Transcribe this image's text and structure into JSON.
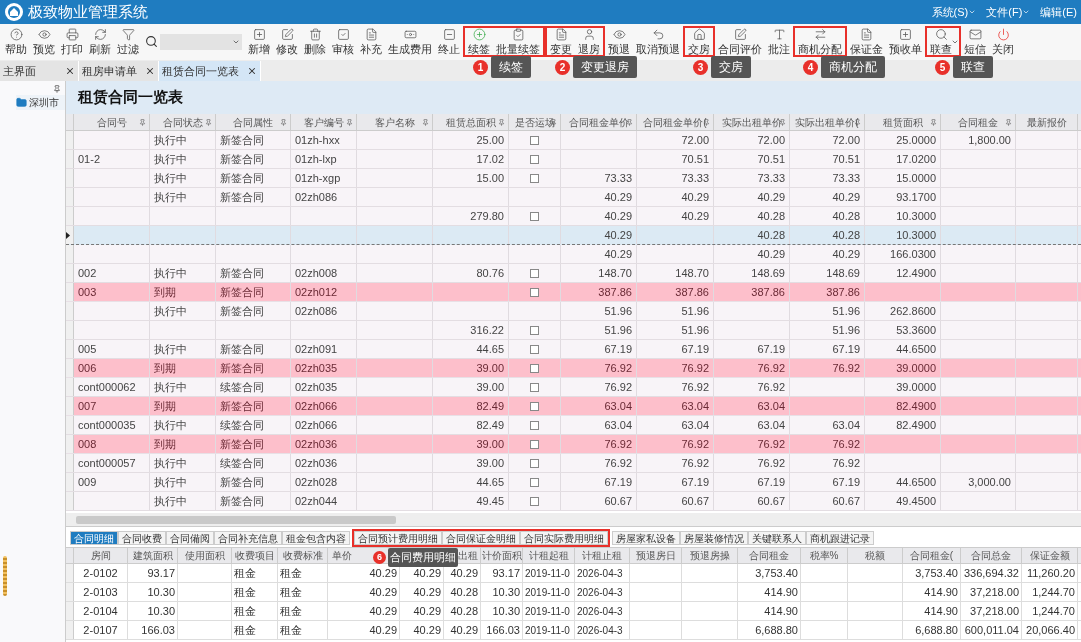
{
  "app": {
    "title": "极致物业管理系统",
    "menus": [
      "系统(S)",
      "文件(F)",
      "编辑(E)"
    ]
  },
  "toolbar": {
    "groups": [
      {
        "items": [
          {
            "label": "帮助"
          },
          {
            "label": "预览"
          },
          {
            "label": "打印"
          },
          {
            "label": "刷新"
          },
          {
            "label": "过滤"
          },
          {
            "kind": "search"
          },
          {
            "label": "新增"
          },
          {
            "label": "修改"
          },
          {
            "label": "删除"
          },
          {
            "label": "审核"
          },
          {
            "label": "补充"
          },
          {
            "label": "生成费用"
          },
          {
            "label": "终止"
          }
        ]
      },
      {
        "callout": {
          "number": "1",
          "label": "续签"
        },
        "items": [
          {
            "label": "续签"
          },
          {
            "label": "批量续签"
          }
        ]
      },
      {
        "callout": {
          "number": "2",
          "label": "变更退房"
        },
        "items": [
          {
            "label": "变更"
          },
          {
            "label": "退房"
          }
        ]
      },
      {
        "items": [
          {
            "label": "预退"
          },
          {
            "label": "取消预退"
          }
        ]
      },
      {
        "callout": {
          "number": "3",
          "label": "交房"
        },
        "items": [
          {
            "label": "交房"
          }
        ]
      },
      {
        "items": [
          {
            "label": "合同评价"
          },
          {
            "label": "批注"
          }
        ]
      },
      {
        "callout": {
          "number": "4",
          "label": "商机分配"
        },
        "items": [
          {
            "label": "商机分配"
          }
        ]
      },
      {
        "items": [
          {
            "label": "保证金"
          },
          {
            "label": "预收单"
          }
        ]
      },
      {
        "callout": {
          "number": "5",
          "label": "联查"
        },
        "items": [
          {
            "label": "联查",
            "dropdown": true
          }
        ]
      },
      {
        "items": [
          {
            "label": "短信"
          },
          {
            "label": "关闭"
          }
        ]
      }
    ]
  },
  "doc_tabs": [
    {
      "label": "主界面",
      "selected": false
    },
    {
      "label": "租房申请单",
      "selected": false
    },
    {
      "label": "租赁合同一览表",
      "selected": true
    }
  ],
  "sidebar": {
    "items": [
      {
        "label": "深圳市"
      }
    ]
  },
  "page_title": "租赁合同一览表",
  "table": {
    "columns": [
      "合同号",
      "合同状态",
      "合同属性",
      "客户编号",
      "客户名称",
      "租赁总面积",
      "是否运场",
      "合同租金单价",
      "合同租金单价(",
      "实际出租单价",
      "实际出租单价(",
      "租赁面积",
      "合同租金",
      "最新报价"
    ],
    "rows": [
      {
        "selected": false,
        "expired": false,
        "status": "执行中",
        "attr": "新签合同",
        "cust": "01zh-hxx",
        "area": "25.00",
        "checked": false,
        "p2": "72.00",
        "p3": "72.00",
        "p4": "72.00",
        "lease_area": "25.0000",
        "rent": "1,800.00"
      },
      {
        "selected": false,
        "expired": false,
        "no": "01-2",
        "status": "执行中",
        "attr": "新签合同",
        "cust": "01zh-lxp",
        "area": "17.02",
        "checked": false,
        "p2": "70.51",
        "p3": "70.51",
        "p4": "70.51",
        "lease_area": "17.0200"
      },
      {
        "selected": false,
        "expired": false,
        "status": "执行中",
        "attr": "新签合同",
        "cust": "01zh-xgp",
        "area": "15.00",
        "checked": false,
        "p1": "73.33",
        "p2": "73.33",
        "p3": "73.33",
        "p4": "73.33",
        "lease_area": "15.0000"
      },
      {
        "selected": false,
        "expired": false,
        "status": "执行中",
        "attr": "新签合同",
        "cust": "02zh086",
        "p1": "40.29",
        "p2": "40.29",
        "p3": "40.29",
        "p4": "40.29",
        "lease_area": "93.1700"
      },
      {
        "selected": false,
        "expired": false,
        "area": "279.80",
        "checked": false,
        "p1": "40.29",
        "p2": "40.29",
        "p3": "40.28",
        "p4": "40.28",
        "lease_area": "10.3000"
      },
      {
        "selected": true,
        "expired": false,
        "p1": "40.29",
        "p3": "40.28",
        "p4": "40.28",
        "lease_area": "10.3000"
      },
      {
        "selected": false,
        "expired": false,
        "p1": "40.29",
        "p3": "40.29",
        "p4": "40.29",
        "lease_area": "166.0300"
      },
      {
        "selected": false,
        "expired": false,
        "no": "002",
        "status": "执行中",
        "attr": "新签合同",
        "cust": "02zh008",
        "area": "80.76",
        "checked": false,
        "p1": "148.70",
        "p2": "148.70",
        "p3": "148.69",
        "p4": "148.69",
        "lease_area": "12.4900"
      },
      {
        "selected": false,
        "expired": true,
        "no": "003",
        "status": "到期",
        "attr": "新签合同",
        "cust": "02zh012",
        "checked": false,
        "p1": "387.86",
        "p2": "387.86",
        "p3": "387.86",
        "p4": "387.86"
      },
      {
        "selected": false,
        "expired": false,
        "status": "执行中",
        "attr": "新签合同",
        "cust": "02zh086",
        "p1": "51.96",
        "p2": "51.96",
        "p4": "51.96",
        "lease_area": "262.8600"
      },
      {
        "selected": false,
        "expired": false,
        "area": "316.22",
        "checked": false,
        "p1": "51.96",
        "p2": "51.96",
        "p4": "51.96",
        "lease_area": "53.3600"
      },
      {
        "selected": false,
        "expired": false,
        "no": "005",
        "status": "执行中",
        "attr": "新签合同",
        "cust": "02zh091",
        "area": "44.65",
        "checked": false,
        "p1": "67.19",
        "p2": "67.19",
        "p3": "67.19",
        "p4": "67.19",
        "lease_area": "44.6500"
      },
      {
        "selected": false,
        "expired": true,
        "no": "006",
        "status": "到期",
        "attr": "新签合同",
        "cust": "02zh035",
        "area": "39.00",
        "checked": false,
        "p1": "76.92",
        "p2": "76.92",
        "p3": "76.92",
        "p4": "76.92",
        "lease_area": "39.0000"
      },
      {
        "selected": false,
        "expired": false,
        "no": "cont000062",
        "status": "执行中",
        "attr": "续签合同",
        "cust": "02zh035",
        "area": "39.00",
        "checked": false,
        "p1": "76.92",
        "p2": "76.92",
        "p3": "76.92",
        "lease_area": "39.0000"
      },
      {
        "selected": false,
        "expired": true,
        "no": "007",
        "status": "到期",
        "attr": "新签合同",
        "cust": "02zh066",
        "area": "82.49",
        "checked": false,
        "p1": "63.04",
        "p2": "63.04",
        "p3": "63.04",
        "lease_area": "82.4900"
      },
      {
        "selected": false,
        "expired": false,
        "no": "cont000035",
        "status": "执行中",
        "attr": "续签合同",
        "cust": "02zh066",
        "area": "82.49",
        "checked": false,
        "p1": "63.04",
        "p2": "63.04",
        "p3": "63.04",
        "p4": "63.04",
        "lease_area": "82.4900"
      },
      {
        "selected": false,
        "expired": true,
        "no": "008",
        "status": "到期",
        "attr": "新签合同",
        "cust": "02zh036",
        "area": "39.00",
        "checked": false,
        "p1": "76.92",
        "p2": "76.92",
        "p3": "76.92",
        "p4": "76.92"
      },
      {
        "selected": false,
        "expired": false,
        "no": "cont000057",
        "status": "执行中",
        "attr": "续签合同",
        "cust": "02zh036",
        "area": "39.00",
        "checked": false,
        "p1": "76.92",
        "p2": "76.92",
        "p3": "76.92",
        "p4": "76.92"
      },
      {
        "selected": false,
        "expired": false,
        "no": "009",
        "status": "执行中",
        "attr": "新签合同",
        "cust": "02zh028",
        "area": "44.65",
        "checked": false,
        "p1": "67.19",
        "p2": "67.19",
        "p3": "67.19",
        "p4": "67.19",
        "lease_area": "44.6500",
        "rent": "3,000.00"
      },
      {
        "selected": false,
        "expired": false,
        "status": "执行中",
        "attr": "新签合同",
        "cust": "02zh044",
        "area": "49.45",
        "checked": false,
        "p1": "60.67",
        "p2": "60.67",
        "p3": "60.67",
        "p4": "60.67",
        "lease_area": "49.4500"
      }
    ]
  },
  "detail_tabs": [
    {
      "tabs": [
        {
          "label": "合同明细",
          "selected": true
        },
        {
          "label": "合同收费",
          "selected": false
        },
        {
          "label": "合同備阅",
          "selected": false
        },
        {
          "label": "合同补充信息",
          "selected": false
        },
        {
          "label": "租金包含内容",
          "selected": false
        }
      ]
    },
    {
      "callout": {
        "number": "6",
        "label": "合同费用明细"
      },
      "tabs": [
        {
          "label": "合同预计费用明细",
          "selected": false
        },
        {
          "label": "合同保证金明细",
          "selected": false
        },
        {
          "label": "合同实际费用明细",
          "selected": false
        }
      ]
    },
    {
      "tabs": [
        {
          "label": "房屋家私设备",
          "selected": false
        },
        {
          "label": "房屋装修情况",
          "selected": false
        },
        {
          "label": "关键联系人",
          "selected": false
        },
        {
          "label": "商机跟进记录",
          "selected": false
        }
      ]
    }
  ],
  "detail_table": {
    "columns": [
      "房间",
      "建筑面积",
      "使用面积",
      "收费项目",
      "收费标准",
      "单价",
      null,
      "出租",
      "计价面积",
      "计租起租",
      "计租止租",
      "预退房日",
      "预退房操",
      "合同租金",
      "税率%",
      "税额",
      "合同租金(",
      "合同总金",
      "保证金额"
    ],
    "rows": [
      {
        "cells": [
          "2-0102",
          "93.17",
          null,
          "租金",
          "租金",
          "40.29",
          "40.29",
          "40.29",
          "93.17",
          "2019-11-0",
          "2026-04-3",
          null,
          null,
          "3,753.40",
          null,
          null,
          "3,753.40",
          "336,694.32",
          "11,260.20"
        ]
      },
      {
        "cells": [
          "2-0103",
          "10.30",
          null,
          "租金",
          "租金",
          "40.29",
          "40.29",
          "40.28",
          "10.30",
          "2019-11-0",
          "2026-04-3",
          null,
          null,
          "414.90",
          null,
          null,
          "414.90",
          "37,218.00",
          "1,244.70"
        ]
      },
      {
        "cells": [
          "2-0104",
          "10.30",
          null,
          "租金",
          "租金",
          "40.29",
          "40.29",
          "40.28",
          "10.30",
          "2019-11-0",
          "2026-04-3",
          null,
          null,
          "414.90",
          null,
          null,
          "414.90",
          "37,218.00",
          "1,244.70"
        ]
      },
      {
        "cells": [
          "2-0107",
          "166.03",
          null,
          "租金",
          "租金",
          "40.29",
          "40.29",
          "40.29",
          "166.03",
          "2019-11-0",
          "2026-04-3",
          null,
          null,
          "6,688.80",
          null,
          null,
          "6,688.80",
          "600,011.04",
          "20,066.40"
        ]
      }
    ]
  }
}
